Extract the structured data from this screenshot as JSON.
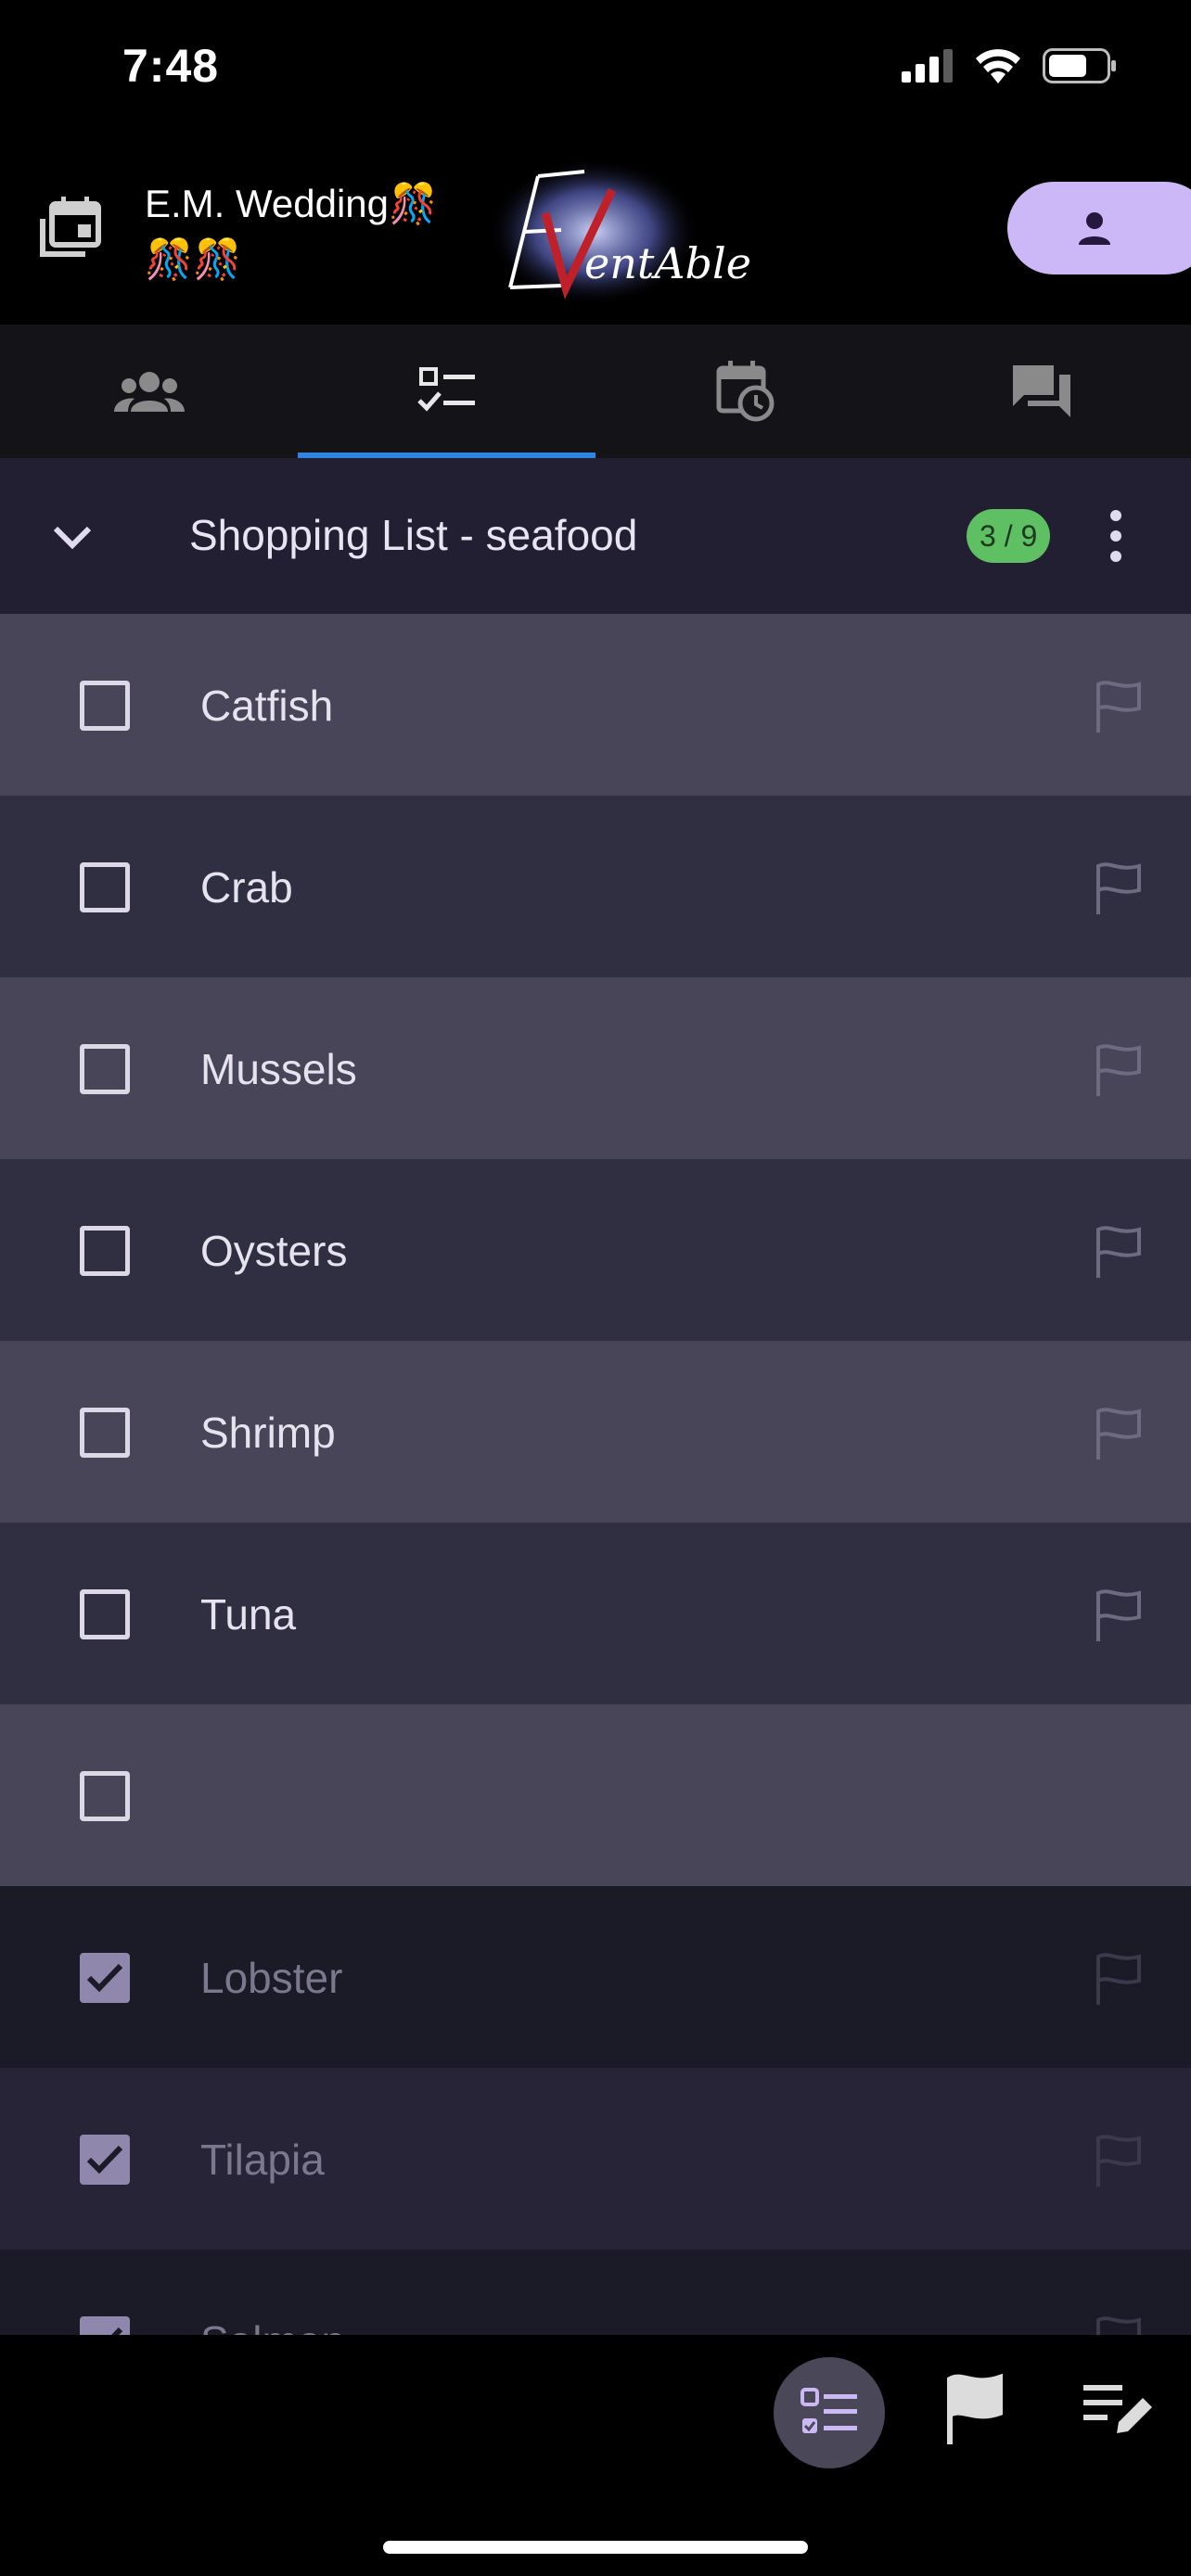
{
  "status_bar": {
    "time": "7:48",
    "icons": [
      "cellular-icon",
      "wifi-icon",
      "battery-icon"
    ]
  },
  "header": {
    "event_title": "E.M. Wedding🎊🎊🎊",
    "logo_text": "EVentAble",
    "profile_icon": "person-icon"
  },
  "tabs": [
    {
      "icon": "people-icon",
      "active": false
    },
    {
      "icon": "checklist-icon",
      "active": true
    },
    {
      "icon": "calendar-clock-icon",
      "active": false
    },
    {
      "icon": "chat-icon",
      "active": false
    }
  ],
  "list": {
    "title": "Shopping List - seafood",
    "count": "3 / 9",
    "items": [
      {
        "label": "Catfish",
        "checked": false
      },
      {
        "label": "Crab",
        "checked": false
      },
      {
        "label": "Mussels",
        "checked": false
      },
      {
        "label": "Oysters",
        "checked": false
      },
      {
        "label": "Shrimp",
        "checked": false
      },
      {
        "label": "Tuna",
        "checked": false
      },
      {
        "label": "",
        "checked": false
      },
      {
        "label": "Lobster",
        "checked": true
      },
      {
        "label": "Tilapia",
        "checked": true
      },
      {
        "label": "Salmon",
        "checked": true
      }
    ]
  },
  "bottom_bar": {
    "icons": [
      "checklist-icon",
      "flag-icon",
      "edit-list-icon"
    ]
  },
  "colors": {
    "accent_tab": "#2f86e0",
    "badge_green": "#5fbf63",
    "profile_purple": "#cdb8f7"
  }
}
